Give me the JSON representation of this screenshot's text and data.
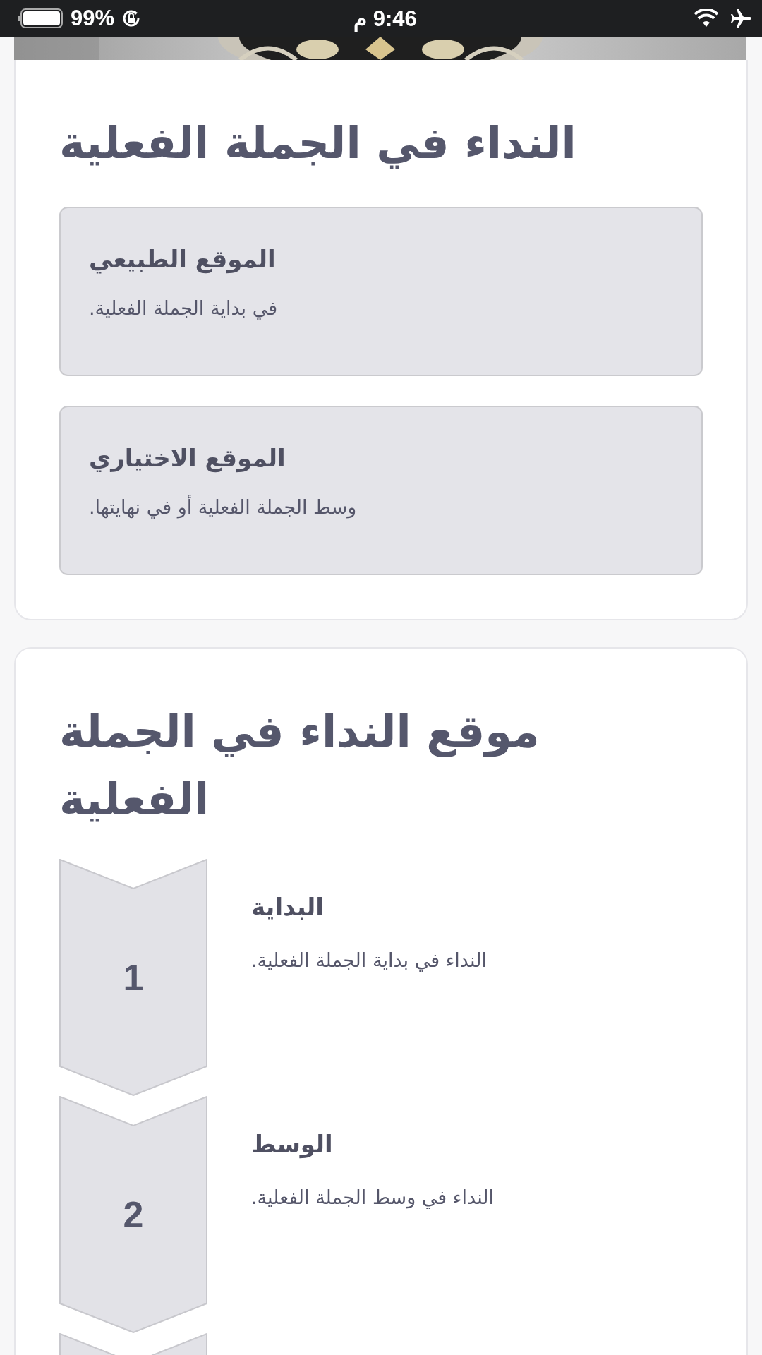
{
  "status_bar": {
    "battery": "99%",
    "time": "9:46 م"
  },
  "sections": [
    {
      "title": "النداء في الجملة الفعلية",
      "kind": "boxes",
      "items": [
        {
          "heading": "الموقع الطبيعي",
          "text": "في بداية الجملة الفعلية."
        },
        {
          "heading": "الموقع الاختياري",
          "text": "وسط الجملة الفعلية أو في نهايتها."
        }
      ]
    },
    {
      "title": "موقع النداء في الجملة الفعلية",
      "kind": "steps",
      "items": [
        {
          "number": "1",
          "heading": "البداية",
          "text": "النداء في بداية الجملة الفعلية."
        },
        {
          "number": "2",
          "heading": "الوسط",
          "text": "النداء في وسط الجملة الفعلية."
        }
      ]
    }
  ]
}
